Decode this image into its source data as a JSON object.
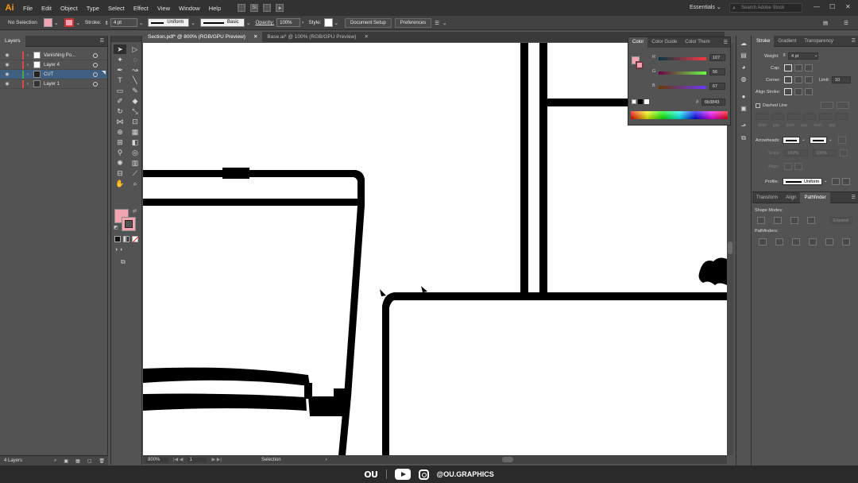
{
  "menubar": {
    "logo": "Ai",
    "items": [
      "File",
      "Edit",
      "Object",
      "Type",
      "Select",
      "Effect",
      "View",
      "Window",
      "Help"
    ],
    "workspace": "Essentials",
    "search_placeholder": "Search Adobe Stock",
    "st_label": "St"
  },
  "controlbar": {
    "selection": "No Selection",
    "stroke_label": "Stroke:",
    "stroke_weight": "4 pt",
    "profile": "Uniform",
    "brush": "Basic",
    "opacity_label": "Opacity:",
    "opacity": "100%",
    "style_label": "Style:",
    "document_setup": "Document Setup",
    "preferences": "Preferences",
    "fill_color": "#f2a5b0"
  },
  "layers": {
    "tab": "Layers",
    "rows": [
      {
        "name": "Vanishing Po...",
        "color": "#e04848"
      },
      {
        "name": "Layer 4",
        "color": "#e04848"
      },
      {
        "name": "CUT",
        "color": "#4aa84a"
      },
      {
        "name": "Layer 1",
        "color": "#e04848"
      }
    ],
    "footer": "4 Layers"
  },
  "documents": {
    "tabs": [
      {
        "label": "Section.pdf* @ 800% (RGB/GPU Preview)",
        "active": true
      },
      {
        "label": "Base.ai* @ 100% (RGB/GPU Preview)",
        "active": false
      }
    ]
  },
  "status": {
    "zoom": "800%",
    "artboard": "1",
    "tool": "Selection"
  },
  "color_panel": {
    "tabs": [
      "Color",
      "Color Guide",
      "Color Them"
    ],
    "r_label": "R",
    "g_label": "G",
    "b_label": "B",
    "r": "107",
    "g": "56",
    "b": "67",
    "hex_prefix": "#",
    "hex": "6b3843"
  },
  "stroke_panel": {
    "tabs": [
      "Stroke",
      "Gradient",
      "Transparency"
    ],
    "weight_label": "Weight:",
    "weight": "4 pt",
    "cap_label": "Cap:",
    "corner_label": "Corner:",
    "limit_label": "Limit:",
    "limit": "10",
    "align_label": "Align Stroke:",
    "dashed_label": "Dashed Line",
    "dash_labels": [
      "dash",
      "gap",
      "dash",
      "gap",
      "dash",
      "gap"
    ],
    "arrowheads_label": "Arrowheads:",
    "scale_label": "Scale:",
    "scale1": "100%",
    "scale2": "100%",
    "align2_label": "Align:",
    "profile_label": "Profile:",
    "profile": "Uniform"
  },
  "pathfinder_panel": {
    "tabs": [
      "Transform",
      "Align",
      "Pathfinder"
    ],
    "shape_modes": "Shape Modes:",
    "expand": "Expand",
    "pathfinders": "Pathfinders:"
  },
  "brand": {
    "logo": "OU",
    "handle": "@OU.GRAPHICS"
  }
}
